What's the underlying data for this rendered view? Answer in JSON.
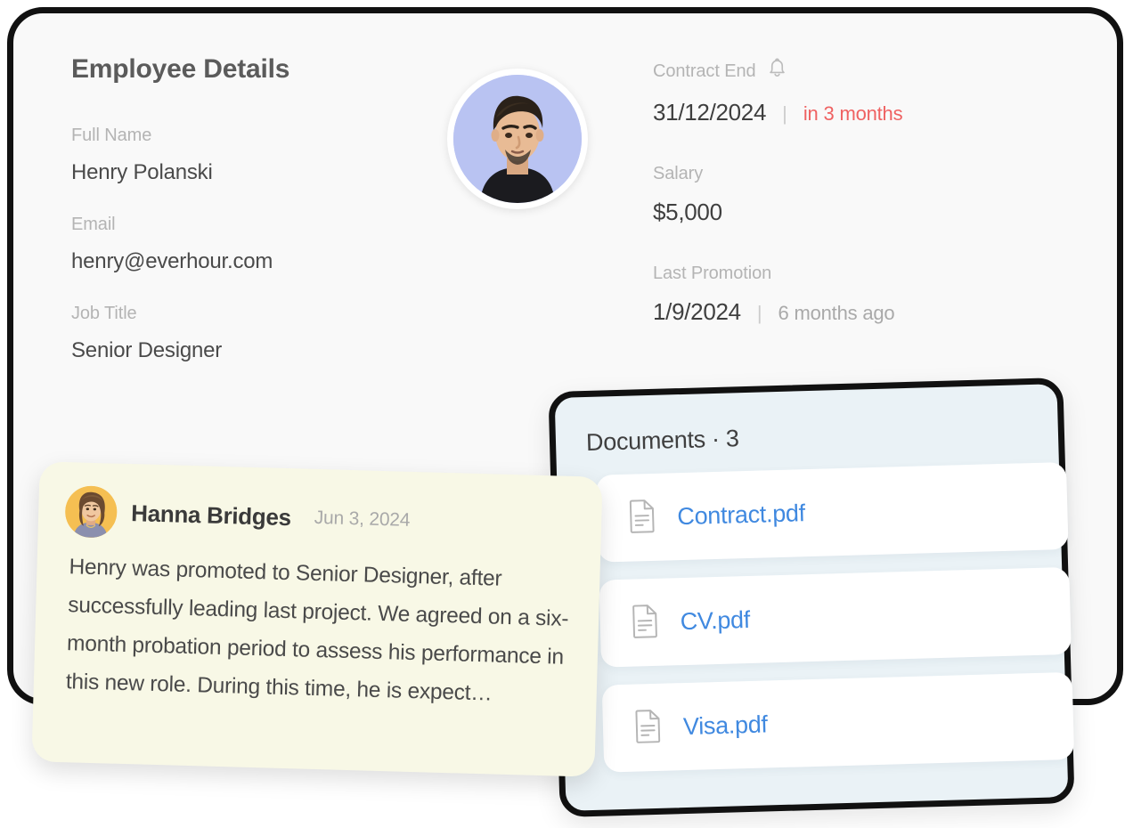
{
  "employee_card": {
    "title": "Employee Details",
    "avatar": {
      "icon": "employee-photo",
      "bg_color": "#b9c3f2",
      "ring_color": "#ffffff"
    },
    "left_fields": [
      {
        "label": "Full Name",
        "value": "Henry Polanski"
      },
      {
        "label": "Email",
        "value": "henry@everhour.com"
      },
      {
        "label": "Job Title",
        "value": "Senior Designer"
      }
    ],
    "right_fields": [
      {
        "label": "Contract End",
        "icon": "bell-icon",
        "value": "31/12/2024",
        "separator": "|",
        "sub_value": "in 3 months",
        "sub_tone": "danger",
        "sub_color": "#ef6262"
      },
      {
        "label": "Salary",
        "icon": null,
        "value": "$5,000",
        "separator": "",
        "sub_value": "",
        "sub_tone": "muted",
        "sub_color": "#a9a9a9"
      },
      {
        "label": "Last Promotion",
        "icon": null,
        "value": "1/9/2024",
        "separator": "|",
        "sub_value": "6 months ago",
        "sub_tone": "muted",
        "sub_color": "#a9a9a9"
      }
    ],
    "bg_color": "#f9f9f9",
    "border_color": "#111111"
  },
  "documents_panel": {
    "title": "Documents · 3",
    "count": 3,
    "bg_color": "#eaf2f6",
    "link_color": "#4089e0",
    "rows": [
      {
        "icon": "document-icon",
        "name": "Contract.pdf"
      },
      {
        "icon": "document-icon",
        "name": "CV.pdf"
      },
      {
        "icon": "document-icon",
        "name": "Visa.pdf"
      }
    ]
  },
  "note_card": {
    "avatar": {
      "icon": "author-avatar",
      "bg_color": "#f5bf52"
    },
    "author": "Hanna Bridges",
    "date": "Jun 3, 2024",
    "body": "Henry was promoted to Senior Designer, after successfully leading last project. We agreed on a six-month probation period to assess his performance in this new role. During this time, he is expect…",
    "bg_color": "#f8f8e6"
  }
}
